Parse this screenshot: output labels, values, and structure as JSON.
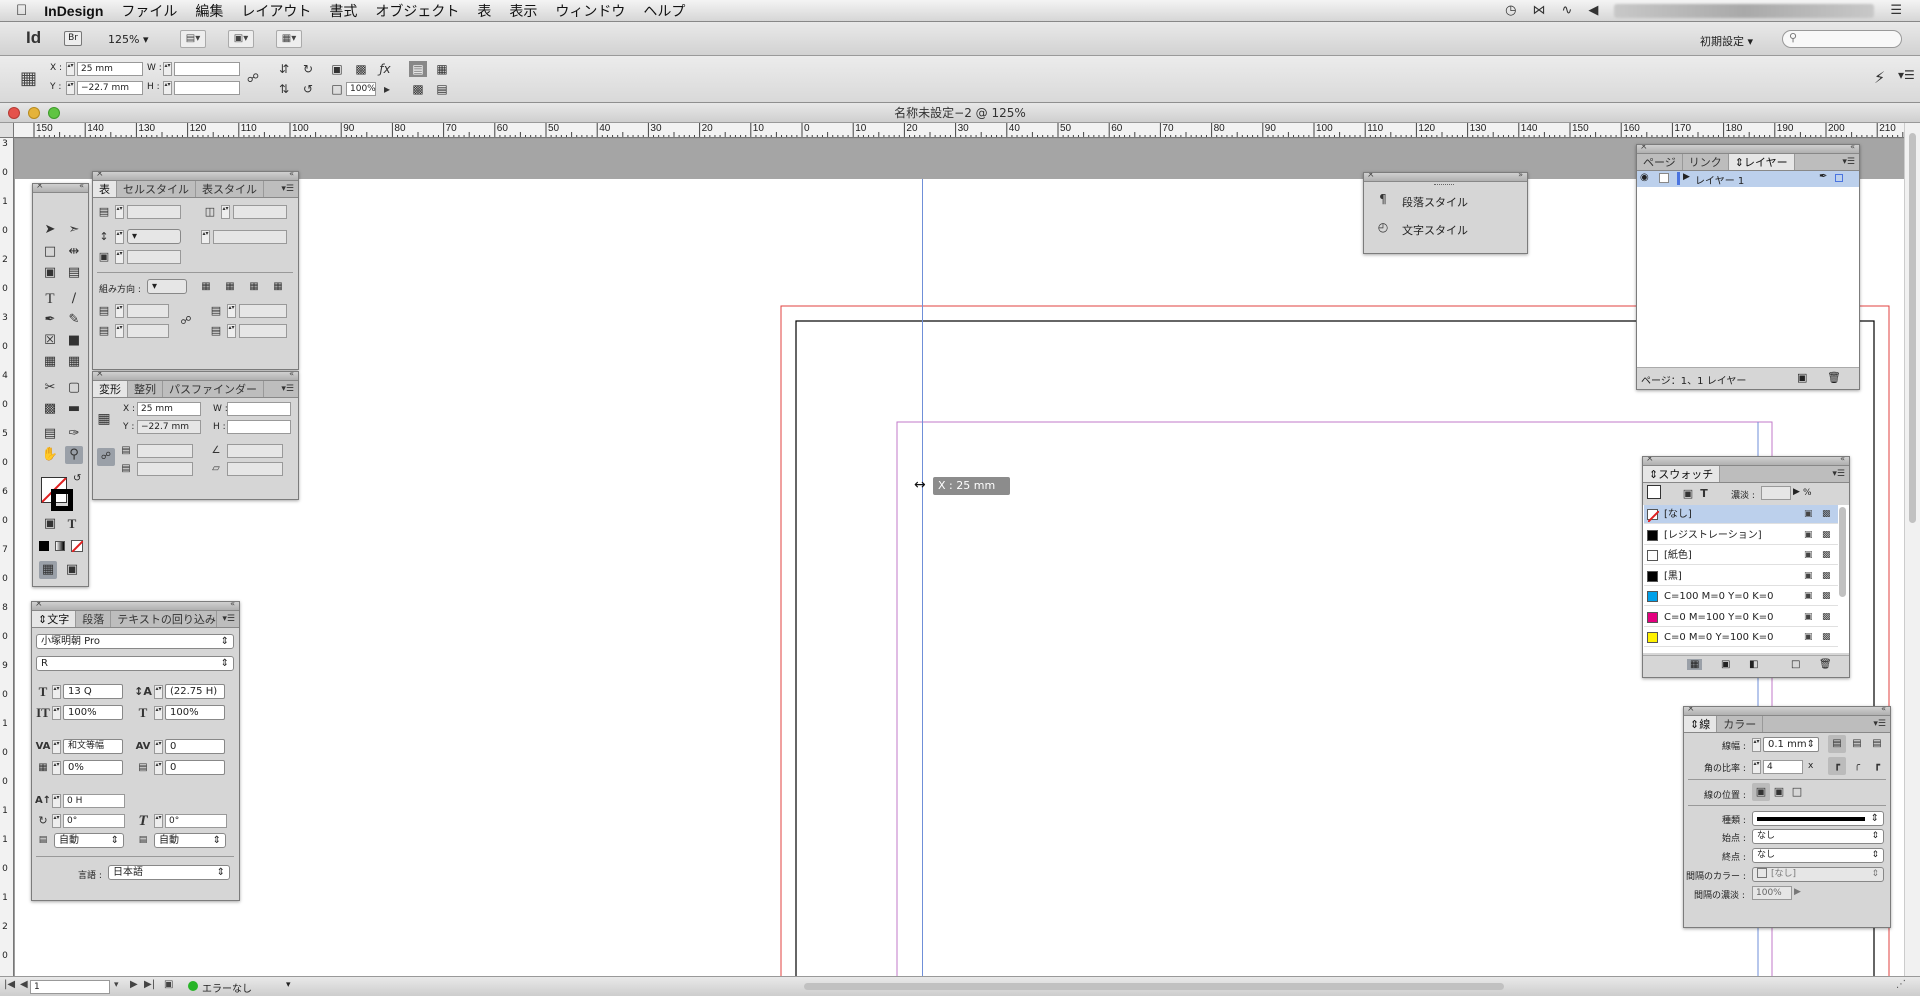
{
  "menubar": {
    "apple": "",
    "app_name": "InDesign",
    "items": [
      "ファイル",
      "編集",
      "レイアウト",
      "書式",
      "オブジェクト",
      "表",
      "表示",
      "ウィンドウ",
      "ヘルプ"
    ],
    "status_icons": [
      "time-machine-icon",
      "bluetooth-icon",
      "wifi-icon",
      "volume-icon"
    ]
  },
  "appbar": {
    "logo": "Id",
    "bridge": "Br",
    "zoom": "125%",
    "workspace": "初期設定",
    "search_placeholder": ""
  },
  "control": {
    "x_label": "X :",
    "x_value": "25 mm",
    "y_label": "Y :",
    "y_value": "−22.7 mm",
    "w_label": "W :",
    "w_value": "",
    "h_label": "H :",
    "h_value": "",
    "scale": "100%"
  },
  "document": {
    "title": "名称未設定−2 @ 125%",
    "guide_tooltip": "X : 25 mm",
    "hruler": [
      "150",
      "140",
      "130",
      "120",
      "110",
      "100",
      "90",
      "80",
      "70",
      "60",
      "50",
      "40",
      "30",
      "20",
      "10",
      "0",
      "10",
      "20",
      "30",
      "40",
      "50",
      "60",
      "70",
      "80",
      "90",
      "100",
      "110",
      "120",
      "130",
      "140",
      "150",
      "160",
      "170",
      "180",
      "190",
      "200",
      "210"
    ],
    "vruler": [
      "3",
      "0",
      "1",
      "0",
      "2",
      "0",
      "3",
      "0",
      "4",
      "0",
      "5",
      "0",
      "6",
      "0",
      "7",
      "0",
      "8",
      "0",
      "9",
      "0",
      "1",
      "0",
      "0",
      "1",
      "1",
      "0",
      "1",
      "2",
      "0"
    ]
  },
  "table_panel": {
    "tabs": [
      "表",
      "セルスタイル",
      "表スタイル"
    ],
    "direction_label": "組み方向 :"
  },
  "transform_panel": {
    "tabs": [
      "変形",
      "整列",
      "パスファインダー"
    ],
    "x_label": "X :",
    "x_value": "25 mm",
    "y_label": "Y :",
    "y_value": "−22.7 mm",
    "w_label": "W :",
    "h_label": "H :"
  },
  "styles_panel": {
    "items": [
      "段落スタイル",
      "文字スタイル"
    ]
  },
  "layers_panel": {
    "tabs": [
      "ページ",
      "リンク",
      "レイヤー"
    ],
    "layer_name": "レイヤー 1",
    "footer": "ページ：1、1 レイヤー"
  },
  "swatches_panel": {
    "tab": "スウォッチ",
    "tint_label": "濃淡 :",
    "tint_unit": "%",
    "rows": [
      {
        "name": "[なし]",
        "color": "#ffffff",
        "selected": true
      },
      {
        "name": "[レジストレーション]",
        "color": "#000000",
        "selected": false
      },
      {
        "name": "[紙色]",
        "color": "#ffffff",
        "selected": false
      },
      {
        "name": "[黒]",
        "color": "#000000",
        "selected": false
      },
      {
        "name": "C=100 M=0 Y=0 K=0",
        "color": "#00a0e9",
        "selected": false
      },
      {
        "name": "C=0 M=100 Y=0 K=0",
        "color": "#e4007f",
        "selected": false
      },
      {
        "name": "C=0 M=0 Y=100 K=0",
        "color": "#fff100",
        "selected": false
      }
    ]
  },
  "character_panel": {
    "tabs": [
      "文字",
      "段落",
      "テキストの回り込み"
    ],
    "font_family": "小塚明朝 Pro",
    "font_style": "R",
    "size": "13 Q",
    "leading": "(22.75 H)",
    "vscale": "100%",
    "hscale": "100%",
    "kerning": "和文等幅",
    "tracking": "0",
    "tsume": "0%",
    "aki": "0",
    "baseline": "0 H",
    "rotate": "0°",
    "skew": "0°",
    "aki_before": "自動",
    "aki_after": "自動",
    "lang_label": "言語 :",
    "lang": "日本語"
  },
  "stroke_panel": {
    "tabs": [
      "線",
      "カラー"
    ],
    "weight_label": "線幅 :",
    "weight": "0.1 mm",
    "miter_label": "角の比率 :",
    "miter": "4",
    "miter_unit": "x",
    "align_label": "線の位置 :",
    "type_label": "種類 :",
    "start_label": "始点 :",
    "start": "なし",
    "end_label": "終点 :",
    "end": "なし",
    "gap_color_label": "間隔のカラー :",
    "gap_color": "[なし]",
    "gap_tint_label": "間隔の濃淡 :",
    "gap_tint": "100%"
  },
  "statusbar": {
    "page": "1",
    "errors": "エラーなし"
  },
  "colors": {
    "bleed": "#e0403f",
    "margin": "#c27ac8",
    "guide": "#6f8fd8",
    "selection": "#bcd0ec"
  }
}
